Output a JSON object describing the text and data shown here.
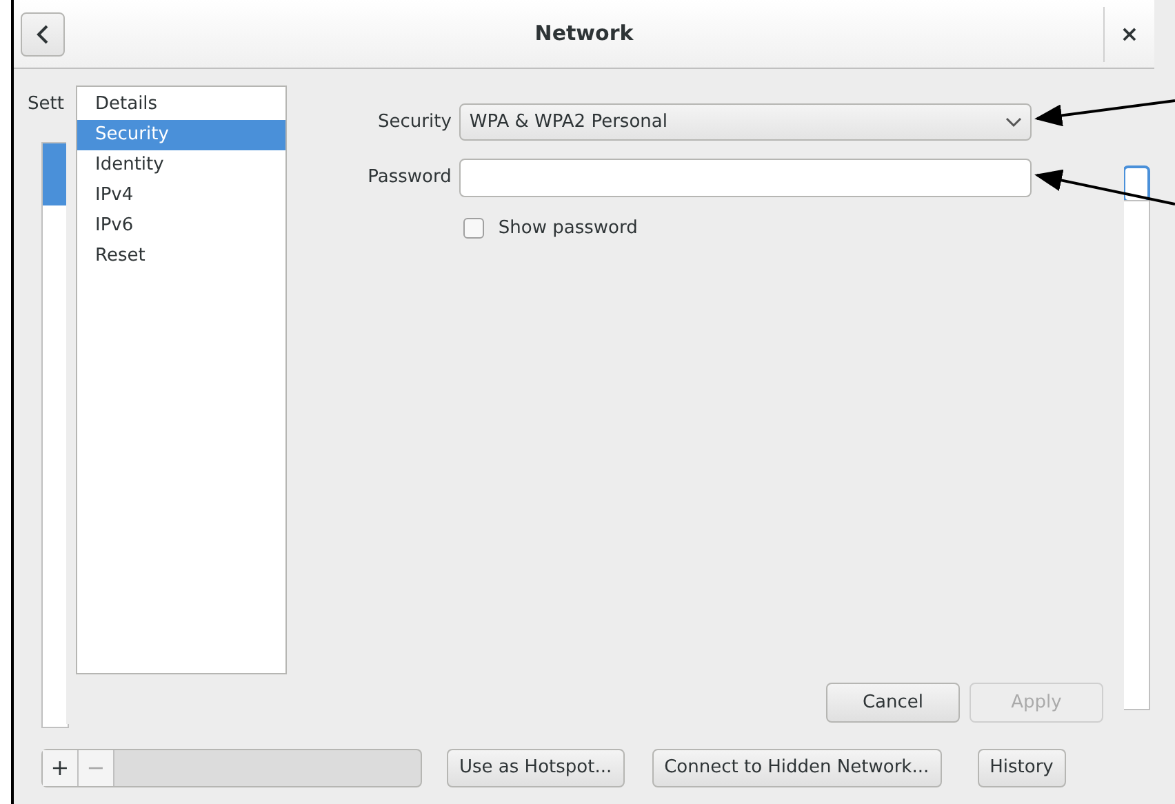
{
  "window": {
    "title": "Network",
    "close": "×"
  },
  "background": {
    "sidebar_label": "Sett",
    "toolbar": [
      "+",
      "−"
    ],
    "buttons": [
      "Use as Hotspot...",
      "Connect to Hidden Network...",
      "History"
    ]
  },
  "dialog": {
    "sections": [
      {
        "label": "Details",
        "selected": false
      },
      {
        "label": "Security",
        "selected": true
      },
      {
        "label": "Identity",
        "selected": false
      },
      {
        "label": "IPv4",
        "selected": false
      },
      {
        "label": "IPv6",
        "selected": false
      },
      {
        "label": "Reset",
        "selected": false
      }
    ],
    "security": {
      "label": "Security",
      "value": "WPA & WPA2 Personal"
    },
    "password": {
      "label": "Password"
    },
    "show_password": {
      "label": "Show password",
      "checked": false
    },
    "buttons": [
      {
        "label": "Cancel",
        "disabled": false
      },
      {
        "label": "Apply",
        "disabled": true
      }
    ]
  }
}
